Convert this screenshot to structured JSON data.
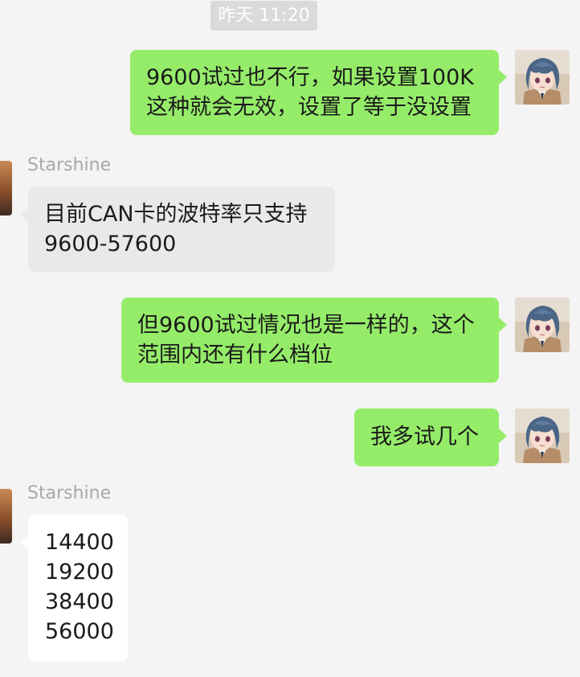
{
  "chat": {
    "timestamp": "昨天 11:20",
    "messages": [
      {
        "direction": "out",
        "lines": [
          "9600试过也不行，如果设置100K",
          "这种就会无效，设置了等于没设置"
        ]
      },
      {
        "direction": "in",
        "sender": "Starshine",
        "lines": [
          "目前CAN卡的波特率只支持",
          "9600-57600"
        ]
      },
      {
        "direction": "out",
        "lines": [
          "但9600试过情况也是一样的，这个",
          "范围内还有什么档位"
        ]
      },
      {
        "direction": "out",
        "lines": [
          "我多试几个"
        ]
      },
      {
        "direction": "in",
        "sender": "Starshine",
        "lines": [
          "14400",
          "19200",
          "38400",
          "56000"
        ]
      }
    ]
  },
  "colors": {
    "background": "#f4f4f4",
    "outgoing_bubble": "#95ec69",
    "incoming_bubble": "#e9e9e9",
    "incoming_bubble_last": "#ffffff",
    "timestamp_bg": "#dadada",
    "sender_name": "#a8a8a8"
  },
  "icons": {
    "self_avatar": "anime-girl-avatar-icon",
    "other_avatar": "contact-avatar-icon"
  }
}
